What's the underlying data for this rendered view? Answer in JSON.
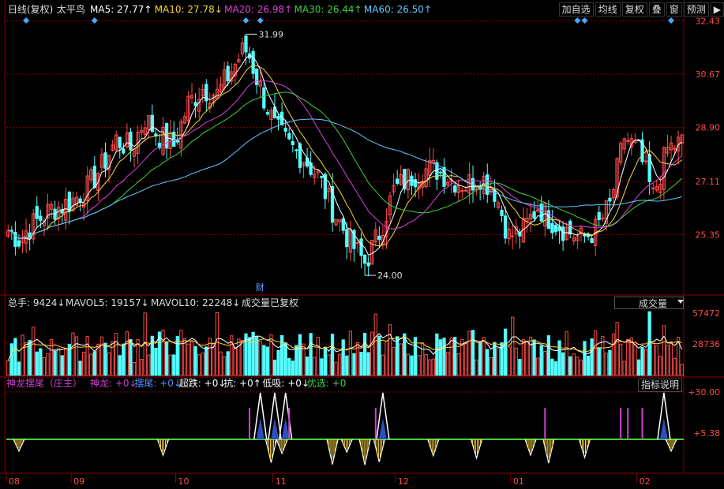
{
  "header": {
    "main_title": "日线(复权)",
    "stock_name": "太平鸟",
    "ma": [
      {
        "label": "MA5: 27.77↑",
        "color": "#ffffff"
      },
      {
        "label": "MA10: 27.78↓",
        "color": "#f7d53c"
      },
      {
        "label": "MA20: 26.98↑",
        "color": "#e040e0"
      },
      {
        "label": "MA30: 26.44↑",
        "color": "#40d040"
      },
      {
        "label": "MA60: 26.50↑",
        "color": "#60c8ff"
      }
    ]
  },
  "toolbar": [
    "加自选",
    "均线",
    "复权",
    "叠",
    "窗",
    "预测",
    "▶"
  ],
  "volume_header": {
    "items": [
      {
        "label": "总手: 9424↓",
        "color": "#dddddd"
      },
      {
        "label": "MAVOL5: 19157↓",
        "color": "#dddddd"
      },
      {
        "label": "MAVOL10: 22248↓",
        "color": "#dddddd"
      },
      {
        "label": "成交量已复权",
        "color": "#dddddd"
      }
    ],
    "dropdown": "成交量"
  },
  "indicator_header": {
    "items": [
      {
        "label": "神龙摆尾（庄主）",
        "color": "#d040d0"
      },
      {
        "label": "神龙: +0↓",
        "color": "#d040d0"
      },
      {
        "label": "摆尾: +0↓",
        "color": "#5a8cff"
      },
      {
        "label": "超跌: +0↓",
        "color": "#ffffff"
      },
      {
        "label": "抗: +0↑",
        "color": "#ffffff"
      },
      {
        "label": "低吸: +0↓",
        "color": "#ffffff"
      },
      {
        "label": "优选: +0",
        "color": "#40d040"
      }
    ],
    "desc_button": "指标说明"
  },
  "colors": {
    "up": "#ff4a4a",
    "down": "#54ffff",
    "grid": "#8a0000",
    "axis_text": "#ff4a4a",
    "bg": "#000000"
  },
  "chart_data": {
    "type": "candlestick",
    "price_axis": {
      "ticks": [
        "32.43",
        "30.67",
        "28.90",
        "27.11",
        "25.35"
      ],
      "ylim": [
        23.4,
        32.6
      ]
    },
    "volume_axis": {
      "ticks": [
        "57472",
        "28736"
      ],
      "ylim": [
        0,
        57472
      ]
    },
    "indicator_axis": {
      "ticks": [
        "+30.00",
        "+5.38"
      ]
    },
    "annotations": {
      "high": "31.99",
      "low": "24.00",
      "event": "财"
    },
    "x_ticks": [
      {
        "label": "08",
        "i": 0
      },
      {
        "label": "09",
        "i": 18
      },
      {
        "label": "10",
        "i": 47
      },
      {
        "label": "11",
        "i": 74
      },
      {
        "label": "12",
        "i": 108
      },
      {
        "label": "01",
        "i": 140
      },
      {
        "label": "02",
        "i": 175
      }
    ],
    "high_index": 66,
    "low_index": 99,
    "event_index": 70,
    "keypoints": [
      [
        0,
        25.5
      ],
      [
        3,
        25.2
      ],
      [
        6,
        25.6
      ],
      [
        9,
        25.9
      ],
      [
        12,
        26.2
      ],
      [
        15,
        26.3
      ],
      [
        18,
        26.5
      ],
      [
        22,
        26.9
      ],
      [
        26,
        27.6
      ],
      [
        30,
        28.5
      ],
      [
        34,
        28.2
      ],
      [
        38,
        29.2
      ],
      [
        42,
        28.6
      ],
      [
        46,
        28.3
      ],
      [
        50,
        29.7
      ],
      [
        54,
        30.2
      ],
      [
        58,
        30.0
      ],
      [
        62,
        30.8
      ],
      [
        66,
        31.6
      ],
      [
        70,
        30.2
      ],
      [
        74,
        28.9
      ],
      [
        78,
        28.3
      ],
      [
        82,
        27.9
      ],
      [
        86,
        27.3
      ],
      [
        90,
        26.2
      ],
      [
        95,
        25.1
      ],
      [
        99,
        24.4
      ],
      [
        103,
        25.4
      ],
      [
        107,
        26.8
      ],
      [
        111,
        27.2
      ],
      [
        115,
        27.5
      ],
      [
        119,
        27.5
      ],
      [
        123,
        27.2
      ],
      [
        127,
        27.0
      ],
      [
        131,
        27.3
      ],
      [
        135,
        26.8
      ],
      [
        139,
        25.3
      ],
      [
        143,
        25.5
      ],
      [
        147,
        26.3
      ],
      [
        151,
        25.8
      ],
      [
        155,
        25.5
      ],
      [
        159,
        25.2
      ],
      [
        163,
        25.5
      ],
      [
        167,
        26.3
      ],
      [
        171,
        28.6
      ],
      [
        175,
        28.1
      ],
      [
        179,
        26.6
      ],
      [
        183,
        28.2
      ],
      [
        187,
        28.4
      ]
    ],
    "count": 188
  }
}
